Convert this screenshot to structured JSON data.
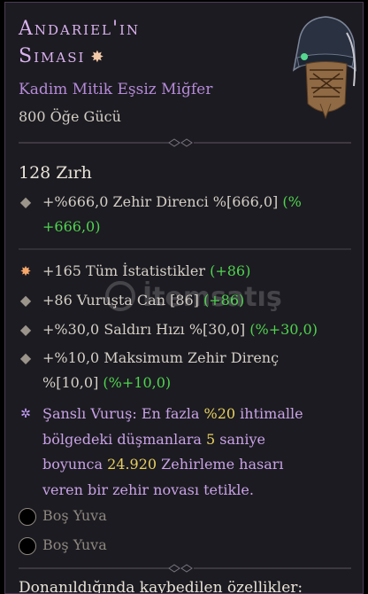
{
  "item": {
    "name_line1": "Andarıel'in",
    "name_line2": "Sıması",
    "type": "Kadim Mitik Eşsiz Miğfer",
    "item_power": "800 Öğe Gücü",
    "armor": "128 Zırh"
  },
  "implicit": {
    "line1": "+%666,0 Zehir Direnci %[666,0] ",
    "line1_green": "(%",
    "line2_green": "+666,0)"
  },
  "affixes": [
    {
      "text": "+165 Tüm İstatistikler ",
      "bonus": "(+86)"
    },
    {
      "text": "+86 Vuruşta Can [86] ",
      "bonus": "(+86)"
    },
    {
      "text": "+%30,0 Saldırı Hızı %[30,0] ",
      "bonus": "(%+30,0)"
    },
    {
      "line1": "+%10,0 Maksimum Zehir Direnç",
      "line2": "%[10,0] ",
      "bonus": "(%+10,0)"
    }
  ],
  "unique_power": {
    "l1a": "Şanslı Vuruş:",
    "l1b": " En fazla ",
    "l1c": "%20",
    "l1d": " ihtimalle",
    "l2a": "bölgedeki düşmanlara ",
    "l2b": "5",
    "l2c": " saniye",
    "l3a": "boyunca ",
    "l3b": "24.920",
    "l3c": " Zehirleme hasarı",
    "l4": "veren bir zehir novası tetikle."
  },
  "sockets": [
    "Boş Yuva",
    "Boş Yuva"
  ],
  "footer": "Donanıldığında kaybedilen özellikler:",
  "colors": {
    "title": "#d9b2ee",
    "green": "#4fd44f",
    "yellow": "#e8d060",
    "unique": "#c8a2e6"
  }
}
